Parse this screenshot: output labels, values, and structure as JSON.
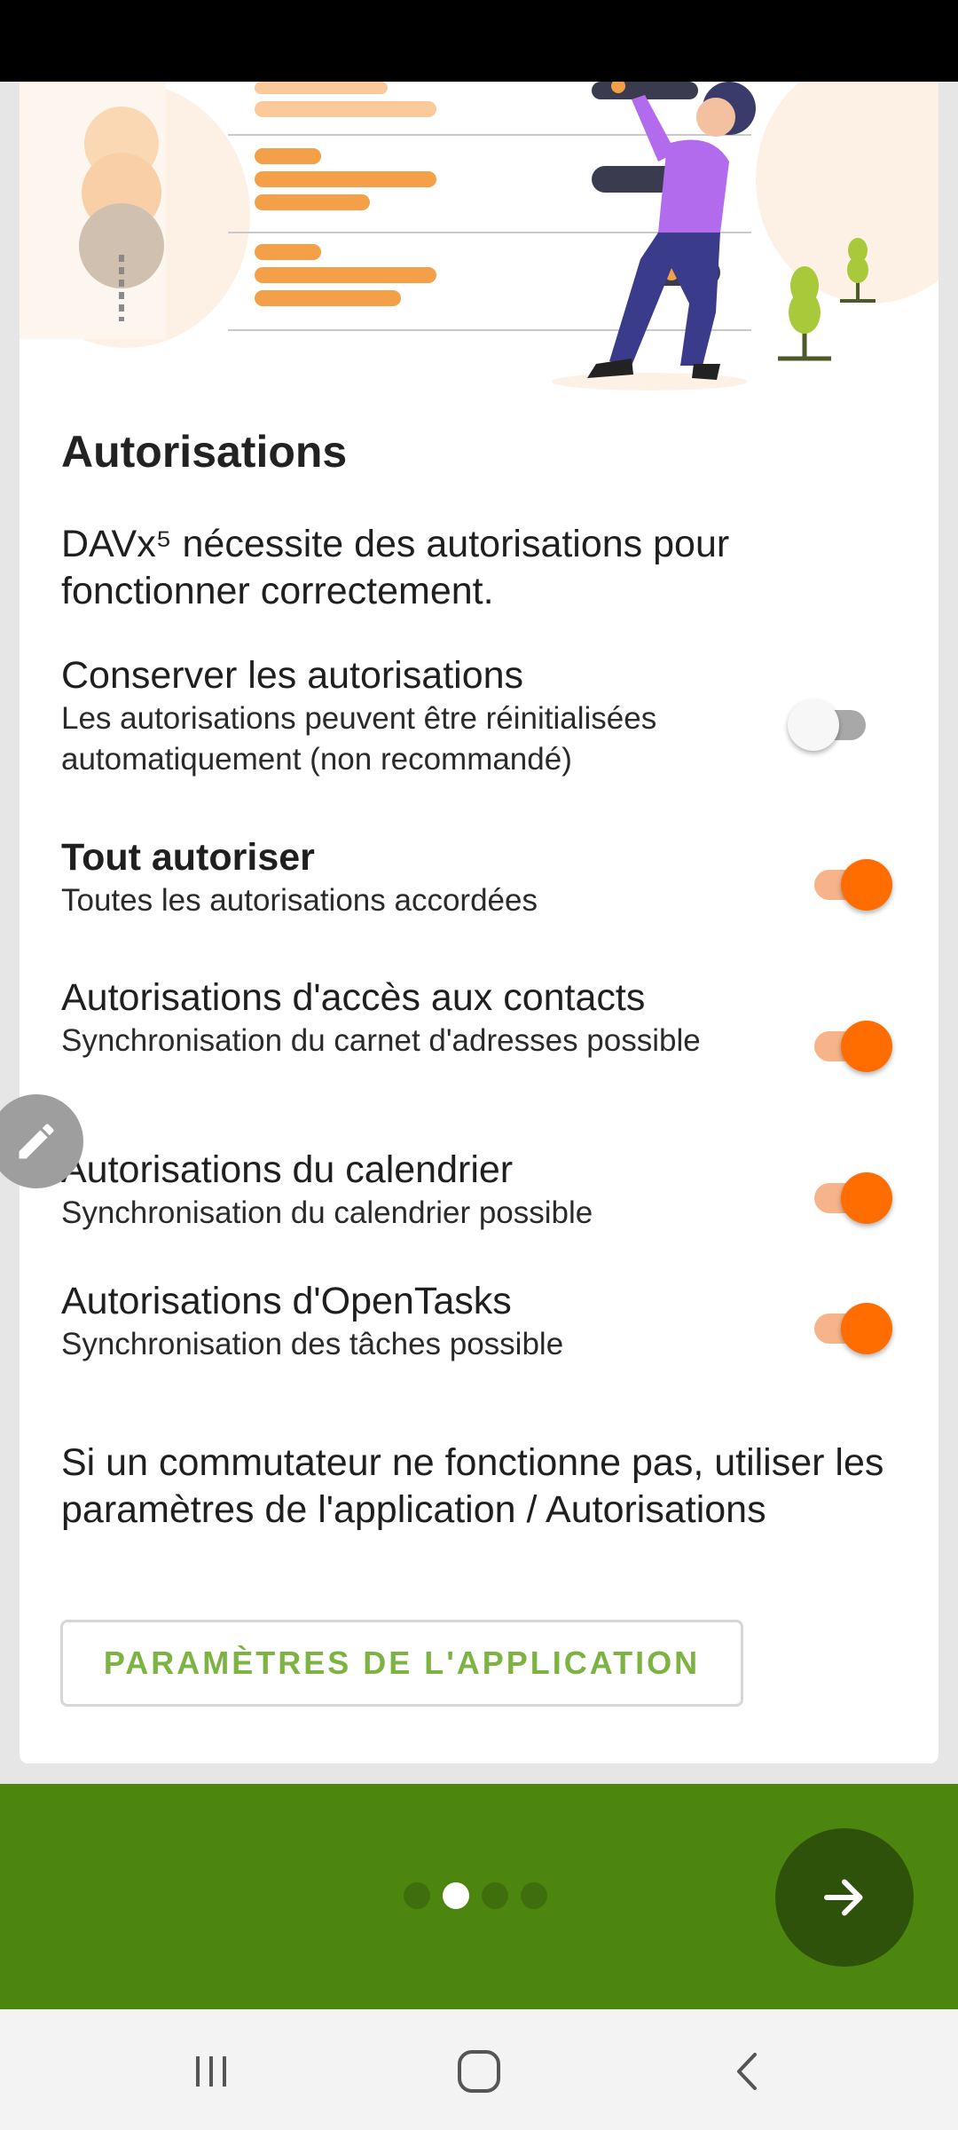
{
  "page": {
    "title": "Autorisations",
    "intro": "DAVx⁵ nécessite des autorisations pour fonctionner correctement."
  },
  "permissions": [
    {
      "title": "Conserver les autorisations",
      "subtitle": "Les autorisations peuvent être réinitialisées automatiquement (non recommandé)",
      "enabled": false
    },
    {
      "title": "Tout autoriser",
      "subtitle": "Toutes les autorisations accordées",
      "enabled": true
    },
    {
      "title": "Autorisations d'accès aux contacts",
      "subtitle": "Synchronisation du carnet d'adresses possible",
      "enabled": true
    },
    {
      "title": "Autorisations du calendrier",
      "subtitle": "Synchronisation du calendrier possible",
      "enabled": true
    },
    {
      "title": "Autorisations d'OpenTasks",
      "subtitle": "Synchronisation des tâches possible",
      "enabled": true
    }
  ],
  "hint": "Si un commutateur ne fonctionne pas, utiliser les paramètres de l'application / Autorisations",
  "settings_button": "PARAMÈTRES DE L'APPLICATION",
  "pager": {
    "total": 4,
    "current_index": 1
  },
  "colors": {
    "accent_orange": "#ff6d00",
    "switch_track_on": "#f7b48a",
    "bottom_bar_green": "#4c860f",
    "next_button_green": "#2f520b",
    "button_text_green": "#7cb342"
  },
  "icons": {
    "edit": "pencil-icon",
    "next": "arrow-right-icon",
    "nav_recents": "recents-icon",
    "nav_home": "home-icon",
    "nav_back": "back-icon"
  }
}
